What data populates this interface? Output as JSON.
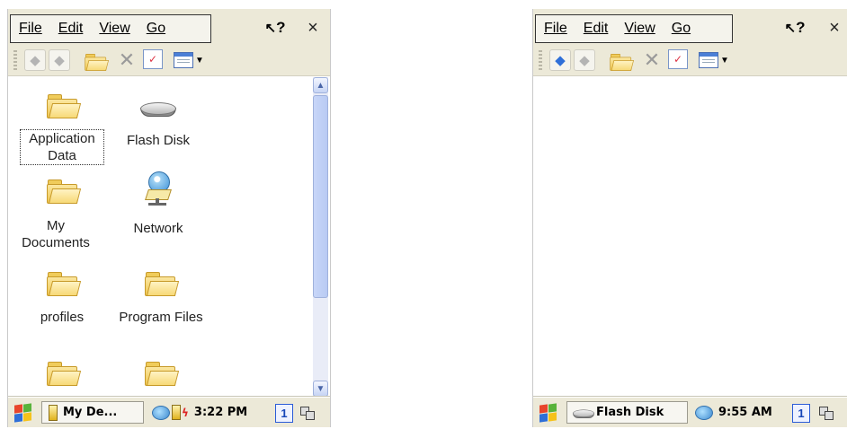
{
  "left": {
    "menu": [
      "File",
      "Edit",
      "View",
      "Go"
    ],
    "items": [
      {
        "label": "Application\nData",
        "type": "folder"
      },
      {
        "label": "Flash Disk",
        "type": "disk"
      },
      {
        "label": "My\nDocuments",
        "type": "folder"
      },
      {
        "label": "Network",
        "type": "network"
      },
      {
        "label": "profiles",
        "type": "folder"
      },
      {
        "label": "Program Files",
        "type": "folder"
      },
      {
        "label": "",
        "type": "folder"
      },
      {
        "label": "",
        "type": "folder"
      }
    ],
    "taskbar": {
      "window_label": "My De...",
      "time": "3:22 PM",
      "desk_num": "1"
    }
  },
  "right": {
    "menu": [
      "File",
      "Edit",
      "View",
      "Go"
    ],
    "taskbar": {
      "window_label": "Flash Disk",
      "time": "9:55 AM",
      "desk_num": "1"
    }
  },
  "icons": {
    "help": "?",
    "close": "×",
    "back": "◆",
    "forward": "◆",
    "up": "up-folder-icon",
    "delete": "✕",
    "properties": "✓",
    "views": "views-icon",
    "scroll_up": "▲",
    "scroll_down": "▼"
  }
}
